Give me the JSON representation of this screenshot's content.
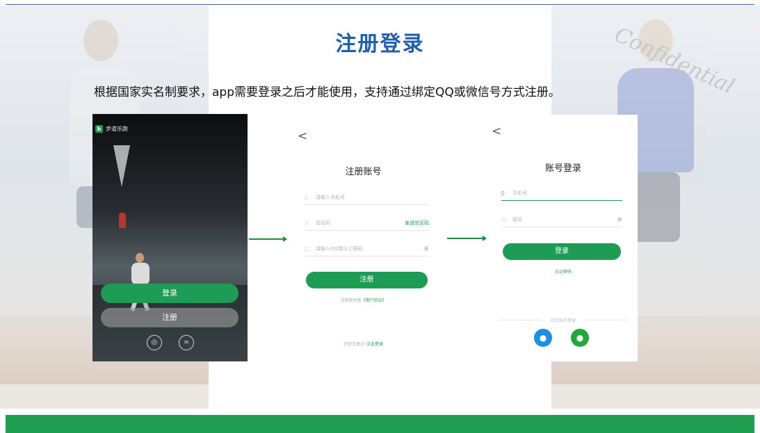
{
  "slide": {
    "title": "注册登录",
    "subtitle": "根据国家实名制要求，app需要登录之后才能使用，支持通过绑定QQ或微信号方式注册。",
    "watermark": "Confidential",
    "accent_color": "#1f9f4f",
    "title_color": "#1f5fb0"
  },
  "screen_welcome": {
    "brand_mark": "b",
    "brand_name": "步道乐跑",
    "login_label": "登录",
    "register_label": "注册",
    "qq_icon": "qq-icon",
    "wechat_icon": "wechat-icon"
  },
  "screen_register": {
    "back": "<",
    "title": "注册账号",
    "phone_placeholder": "请输入手机号",
    "code_placeholder": "验证码",
    "send_code": "发送验证码",
    "password_placeholder": "请输入6位数以上密码",
    "submit": "注册",
    "agreement_prefix": "注册即同意",
    "agreement_link": "《用户协议》",
    "login_prefix": "已经注册过?",
    "login_link": "点此登录"
  },
  "screen_login": {
    "back": "<",
    "title": "账号登录",
    "phone_placeholder": "手机号",
    "password_placeholder": "密码",
    "submit": "登录",
    "forgot": "忘记密码",
    "third_party": "社交账号登录"
  }
}
